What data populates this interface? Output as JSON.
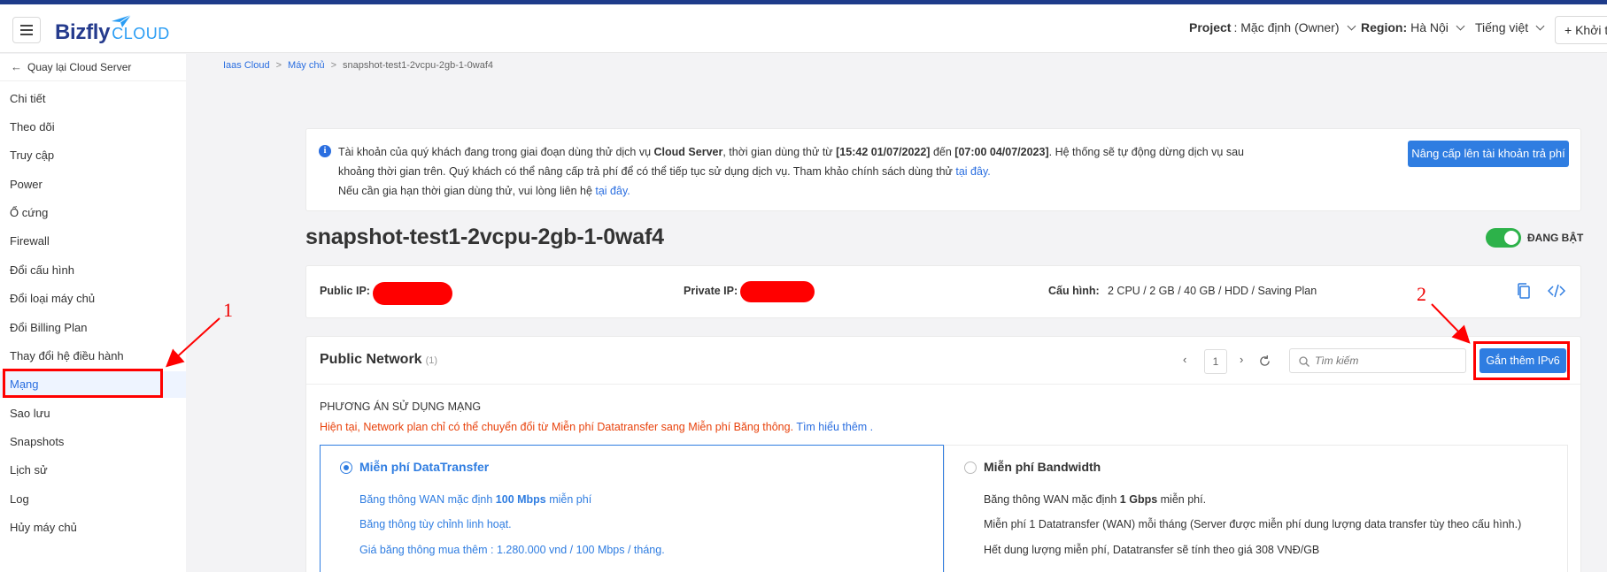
{
  "header": {
    "brand_main": "Bizfly",
    "brand_sub": "CLOUD",
    "project_label": "Project",
    "project_value": ": Mặc định (Owner)",
    "region_label": "Region:",
    "region_value": "Hà Nội",
    "language": "Tiếng việt",
    "create_label": "+ Khởi t"
  },
  "sidebar": {
    "back_label": "Quay lại Cloud Server",
    "items": [
      "Chi tiết",
      "Theo dõi",
      "Truy cập",
      "Power",
      "Ổ cứng",
      "Firewall",
      "Đổi cấu hình",
      "Đổi loại máy chủ",
      "Đổi Billing Plan",
      "Thay đổi hệ điều hành",
      "Mạng",
      "Sao lưu",
      "Snapshots",
      "Lịch sử",
      "Log",
      "Hủy máy chủ"
    ],
    "active_item": "Mạng"
  },
  "breadcrumb": {
    "items": [
      "Iaas Cloud",
      "Máy chủ",
      "snapshot-test1-2vcpu-2gb-1-0waf4"
    ],
    "separator": ">"
  },
  "notice": {
    "line1_a": "Tài khoản của quý khách đang trong giai đoạn dùng thử dịch vụ ",
    "line1_service": "Cloud Server",
    "line1_b": ", thời gian dùng thử từ ",
    "line1_start": "[15:42 01/07/2022]",
    "line1_c": " đến ",
    "line1_end": "[07:00 04/07/2023]",
    "line1_d": ". Hệ thống sẽ tự động dừng dịch vụ sau",
    "line2": "khoảng thời gian trên. Quý khách có thể nâng cấp trả phí để có thể tiếp tục sử dụng dịch vụ. Tham khảo chính sách dùng thử ",
    "line2_link": "tại đây.",
    "line3": "Nếu cần gia hạn thời gian dùng thử, vui lòng liên hệ ",
    "line3_link": "tại đây.",
    "upgrade_button": "Nâng cấp lên tài khoản trả phí"
  },
  "server": {
    "name": "snapshot-test1-2vcpu-2gb-1-0waf4",
    "status": "ĐANG BẬT",
    "public_ip_label": "Public IP:",
    "private_ip_label": "Private IP:",
    "config_label": "Cấu hình:",
    "config_value": "2 CPU / 2 GB / 40 GB / HDD / Saving Plan"
  },
  "network": {
    "title": "Public Network",
    "count": "(1)",
    "page": "1",
    "search_placeholder": "Tìm kiếm",
    "add_ipv6_button": "Gắn thêm IPv6",
    "plan_heading": "PHƯƠNG ÁN SỬ DỤNG MẠNG",
    "plan_note": "Hiện tại, Network plan chỉ có thể chuyển đổi từ Miễn phí Datatransfer sang Miễn phí Băng thông. ",
    "plan_note_link": "Tìm hiểu thêm .",
    "option1": {
      "title": "Miễn phí DataTransfer",
      "line1_a": "Băng thông WAN mặc định ",
      "line1_b": "100 Mbps",
      "line1_c": " miễn phí",
      "line2": "Băng thông tùy chỉnh linh hoạt.",
      "line3": "Giá băng thông mua thêm : 1.280.000 vnd / 100 Mbps / tháng."
    },
    "option2": {
      "title": "Miễn phí Bandwidth",
      "line1_a": "Băng thông WAN mặc định ",
      "line1_b": "1 Gbps",
      "line1_c": " miễn phí.",
      "line2": "Miễn phí 1 Datatransfer (WAN) mỗi tháng (Server được miễn phí dung lượng data transfer tùy theo cấu hình.)",
      "line3": "Hết dung lượng miễn phí, Datatransfer sẽ tính theo giá 308 VNĐ/GB"
    }
  },
  "annotations": {
    "marker1": "1",
    "marker2": "2",
    "color": "#ff0000"
  },
  "colors": {
    "primary": "#2f7de1",
    "brand": "#253b8d",
    "toggle_on": "#2db24a",
    "warning_text": "#e8420c"
  }
}
